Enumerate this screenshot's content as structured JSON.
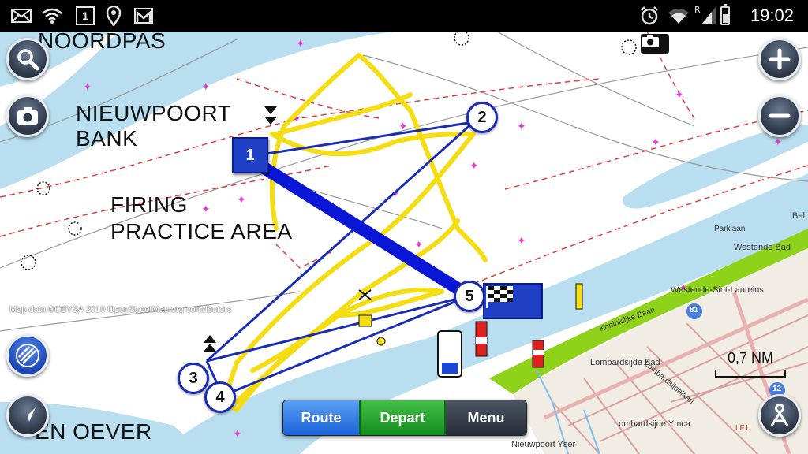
{
  "status_bar": {
    "time": "19:02",
    "icons": [
      "mail-icon",
      "wifi-icon",
      "calendar-icon",
      "location-icon",
      "gmail-icon",
      "alarm-icon",
      "wifi-signal-icon",
      "cell-signal-icon",
      "battery-icon"
    ],
    "calendar_day": "1",
    "roaming_indicator": "R"
  },
  "map": {
    "labels": {
      "noordpas": "NOORDPAS",
      "nieuwpoort_bank_1": "NIEUWPOORT",
      "nieuwpoort_bank_2": "BANK",
      "firing_1": "FIRING",
      "firing_2": "PRACTICE AREA",
      "oever": "EN OEVER"
    },
    "credit": "Map data ©CBYSA 2010 OpenStreetMap.org contributors",
    "towns": {
      "westende_bad": "Westende Bad",
      "sint_laureins": "Westende-Sint-Laureins",
      "lombardsijde_bad": "Lombardsijde Bad",
      "lombardsijde_ymca": "Lombardsijde Ymca",
      "nieuwpoort": "Nieuwpoort Yser",
      "koninklijke_baan": "Koninklijke Baan",
      "lombardsijde_laan": "Lombardsijdelaan",
      "parklaan": "Parklaan",
      "west_bel": "Bel",
      "road_81": "81",
      "road_12": "12",
      "lf1": "LF1"
    },
    "waypoints": [
      {
        "id": "wp-start",
        "label": "1"
      },
      {
        "id": "wp-2",
        "label": "2"
      },
      {
        "id": "wp-3",
        "label": "3"
      },
      {
        "id": "wp-4",
        "label": "4"
      },
      {
        "id": "wp-5",
        "label": "5"
      }
    ],
    "scale": "0,7 NM",
    "colors": {
      "water_shallow": "#b8def0",
      "land": "#ffffff",
      "route_thin": "#1a2bb5",
      "route_thick": "#0a16d6",
      "track": "#f5dd14",
      "shore_green": "#8fd21a"
    }
  },
  "controls": {
    "search": "search-button",
    "camera": "camera-button",
    "zoom_in": "zoom-in-button",
    "zoom_out": "zoom-out-button",
    "layers": "layers-button",
    "navigate": "navigate-button",
    "person": "person-button"
  },
  "bottom_bar": {
    "route_label": "Route",
    "depart_label": "Depart",
    "menu_label": "Menu"
  }
}
